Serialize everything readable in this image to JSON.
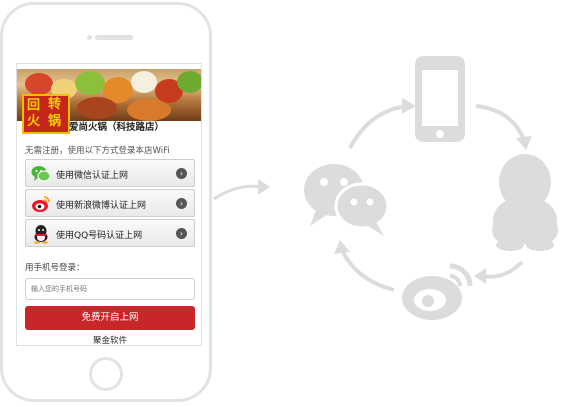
{
  "merchant": {
    "logo_text": [
      "回",
      "转",
      "火",
      "锅"
    ],
    "name": "爱尚火锅（科技路店）"
  },
  "intro_text": "无需注册，使用以下方式登录本店WiFi",
  "login_options": [
    {
      "label": "使用微信认证上网",
      "icon": "wechat-icon"
    },
    {
      "label": "使用新浪微博认证上网",
      "icon": "weibo-icon"
    },
    {
      "label": "使用QQ号码认证上网",
      "icon": "qq-icon"
    }
  ],
  "phone_login": {
    "label": "用手机号登录：",
    "placeholder": "输入您的手机号码",
    "submit_label": "免费开启上网"
  },
  "footer": "聚金软件",
  "diagram": {
    "nodes": [
      "mobile-phone-icon",
      "qq-icon",
      "weibo-icon",
      "wechat-icon"
    ]
  },
  "colors": {
    "accent": "#c9262a",
    "diagram_gray": "#dcdcdc",
    "wechat_green": "#4cb43c",
    "weibo_red": "#e6162d"
  }
}
